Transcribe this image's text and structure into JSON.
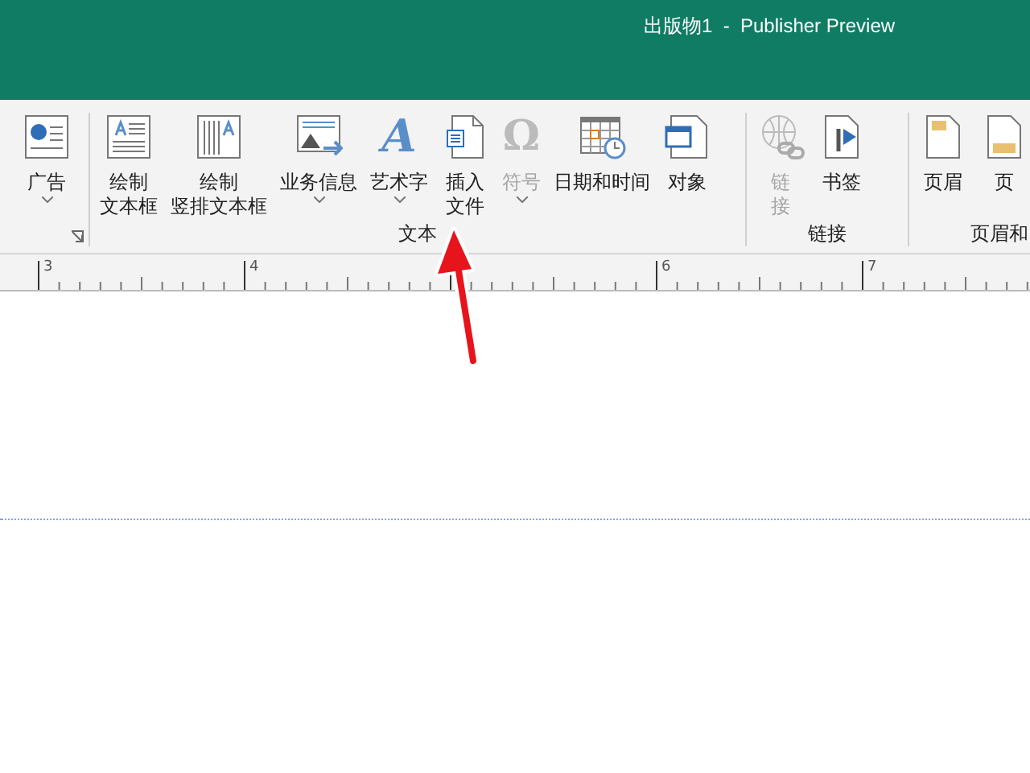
{
  "window": {
    "title": "出版物1  -  Publisher Preview"
  },
  "ribbon": {
    "groups": [
      {
        "launcher": true,
        "buttons": [
          {
            "kind": "ad",
            "lines": [
              "广告"
            ],
            "caret": true,
            "disabled": false
          }
        ]
      },
      {
        "label": "文本",
        "buttons": [
          {
            "kind": "textbox",
            "lines": [
              "绘制",
              "文本框"
            ],
            "disabled": false
          },
          {
            "kind": "vtextbox",
            "lines": [
              "绘制",
              "竖排文本框"
            ],
            "disabled": false
          },
          {
            "kind": "business",
            "lines": [
              "业务信息"
            ],
            "caret": true,
            "disabled": false
          },
          {
            "kind": "wordart",
            "glyph": "A",
            "lines": [
              "艺术字"
            ],
            "caret": true,
            "disabled": false
          },
          {
            "kind": "file",
            "lines": [
              "插入",
              "文件"
            ],
            "disabled": false
          },
          {
            "kind": "symbol",
            "glyph": "Ω",
            "lines": [
              "符号"
            ],
            "caret": true,
            "disabled": true
          },
          {
            "kind": "calendar",
            "lines": [
              "日期和时间"
            ],
            "disabled": false
          },
          {
            "kind": "object",
            "lines": [
              "对象"
            ],
            "disabled": false
          }
        ]
      },
      {
        "label": "链接",
        "buttons": [
          {
            "kind": "link",
            "lines": [
              "链",
              "接"
            ],
            "disabled": true
          },
          {
            "kind": "bookmark",
            "lines": [
              "书签"
            ],
            "disabled": false
          }
        ]
      },
      {
        "label": "页眉和",
        "buttons": [
          {
            "kind": "header",
            "lines": [
              "页眉"
            ],
            "disabled": false
          },
          {
            "kind": "footer",
            "lines": [
              "页"
            ],
            "disabled": false
          }
        ]
      }
    ]
  },
  "ruler": {
    "labels": [
      "3",
      "4",
      "6",
      "7"
    ]
  },
  "annotations": [
    {
      "kind": "arrow"
    }
  ]
}
